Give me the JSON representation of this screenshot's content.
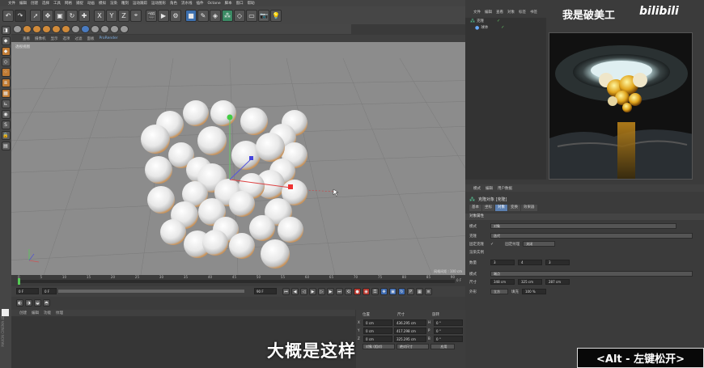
{
  "menubar": {
    "items": [
      "文件",
      "编辑",
      "创建",
      "选择",
      "工具",
      "网格",
      "捕捉",
      "动画",
      "模拟",
      "渲染",
      "雕刻",
      "运动跟踪",
      "运动图形",
      "角色",
      "流水线",
      "插件",
      "Octane",
      "脚本",
      "窗口",
      "帮助"
    ]
  },
  "toolbar": {
    "x_label": "X",
    "y_label": "Y",
    "z_label": "Z"
  },
  "viewport_menu": [
    "查看",
    "摄像机",
    "显示",
    "选项",
    "过滤",
    "面板"
  ],
  "viewport_menu_prorender": "ProRender",
  "viewport": {
    "label": "透视视图",
    "grid_size": "网格间距 : 100 cm"
  },
  "timeline": {
    "ticks": [
      "0",
      "5",
      "10",
      "15",
      "20",
      "25",
      "30",
      "35",
      "40",
      "45",
      "50",
      "55",
      "60",
      "65",
      "70",
      "75",
      "80",
      "85",
      "90"
    ],
    "end_frame": "0 F"
  },
  "transport": {
    "start": "0 F",
    "current": "0 F",
    "end": "90 F",
    "end2": "90 F"
  },
  "material_menu": [
    "创建",
    "编辑",
    "功能",
    "纹理"
  ],
  "coords": {
    "headers": [
      "位置",
      "尺寸",
      "旋转"
    ],
    "rows": [
      {
        "axis": "X",
        "pos": "0 cm",
        "size": "436.295 cm",
        "rot_axis": "H",
        "rot": "0 °"
      },
      {
        "axis": "Y",
        "pos": "0 cm",
        "size": "417.298 cm",
        "rot_axis": "P",
        "rot": "0 °"
      },
      {
        "axis": "Z",
        "pos": "0 cm",
        "size": "325.295 cm",
        "rot_axis": "B",
        "rot": "0 °"
      }
    ],
    "mode": "对象 (相对)",
    "mode2": "绝对尺寸",
    "apply": "应用"
  },
  "right_menu": [
    "文件",
    "编辑",
    "查看",
    "对象",
    "标签",
    "书签"
  ],
  "objects": [
    {
      "name": "克隆",
      "icon": "cloner-icon"
    },
    {
      "name": "球体",
      "icon": "sphere-icon"
    }
  ],
  "watermark": "我是破美工",
  "bilibili": "bilibili",
  "attr_menu": [
    "模式",
    "编辑",
    "用户数据"
  ],
  "attr_title": "克隆对象 [克隆]",
  "attr_tabs": [
    "基本",
    "坐标",
    "对象",
    "变换",
    "效果器"
  ],
  "attr_tab_active": "对象",
  "attr_section": "对象属性",
  "attrs": {
    "mode_label": "模式",
    "mode_value": "对象",
    "clones_label": "克隆",
    "clones_value": "迭代",
    "fixclone_label": "固定克隆",
    "fixtexture_label": "固定纹理",
    "fixtexture_value": "关闭",
    "render_label": "渲染实例",
    "count_label": "数量",
    "count": [
      "3",
      "4",
      "3"
    ],
    "mode2_label": "模式",
    "mode2_value": "端点",
    "size_label": "尺寸",
    "size": [
      "348 cm",
      "325 cm",
      "287 cm"
    ],
    "shape_label": "外形",
    "shape_value": "立方",
    "fill_label": "填充",
    "fill_value": "100 %"
  },
  "subtitle": "大概是这样",
  "key_hint": "<Alt - 左键松开>",
  "logo": "MAXON CINEMA 4D"
}
